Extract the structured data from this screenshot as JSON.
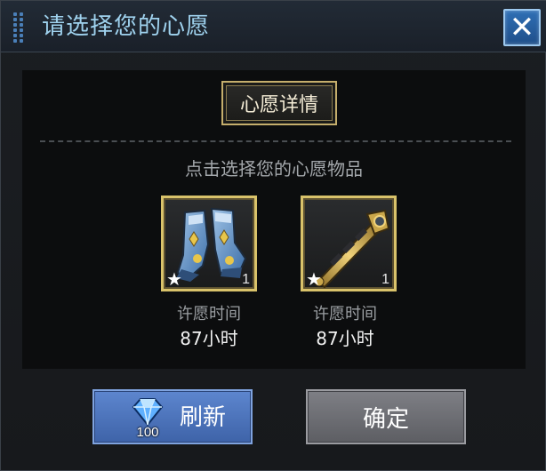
{
  "dialog": {
    "title": "请选择您的心愿",
    "close_icon": "close-icon"
  },
  "tab": {
    "label": "心愿详情"
  },
  "hint": "点击选择您的心愿物品",
  "items": [
    {
      "icon": "armored-boots-icon",
      "count": "1",
      "label": "许愿时间",
      "value": "87小时"
    },
    {
      "icon": "golden-scepter-icon",
      "count": "1",
      "label": "许愿时间",
      "value": "87小时"
    }
  ],
  "buttons": {
    "refresh_label": "刷新",
    "refresh_cost": "100",
    "confirm_label": "确定"
  },
  "colors": {
    "title": "#9fd2ee",
    "slot_border": "#d9c26a",
    "refresh_button": "#4e74bc",
    "confirm_button": "#6e6f74"
  }
}
